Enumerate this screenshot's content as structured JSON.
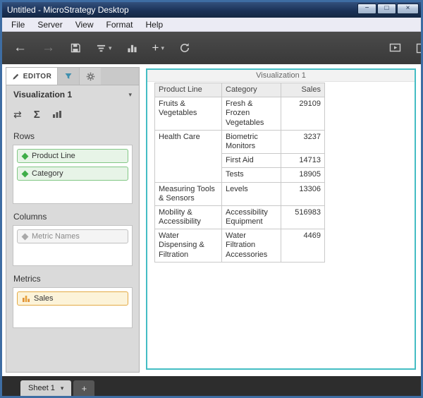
{
  "window": {
    "title": "Untitled - MicroStrategy Desktop"
  },
  "icons": {
    "minimize": "−",
    "maximize": "□",
    "close": "×",
    "back": "←",
    "forward": "→",
    "plus": "+",
    "caret_down": "▾",
    "swap": "⇄",
    "sigma": "Σ"
  },
  "menu": {
    "items": [
      "File",
      "Server",
      "View",
      "Format",
      "Help"
    ]
  },
  "editor": {
    "tab_label": "EDITOR",
    "visualization_name": "Visualization 1",
    "sections": {
      "rows": {
        "label": "Rows",
        "chips": [
          {
            "label": "Product Line"
          },
          {
            "label": "Category"
          }
        ]
      },
      "columns": {
        "label": "Columns",
        "chips": [
          {
            "label": "Metric Names"
          }
        ]
      },
      "metrics": {
        "label": "Metrics",
        "chips": [
          {
            "label": "Sales"
          }
        ]
      }
    }
  },
  "viz": {
    "title": "Visualization 1",
    "table": {
      "headers": [
        "Product Line",
        "Category",
        "Sales"
      ],
      "rows": [
        [
          "Fruits & Vegetables",
          "Fresh & Frozen Vegetables",
          "29109"
        ],
        [
          "Health Care",
          "Biometric Monitors",
          "3237"
        ],
        [
          "First Aid",
          "14713"
        ],
        [
          "Tests",
          "18905"
        ],
        [
          "Measuring Tools & Sensors",
          "Levels",
          "13306"
        ],
        [
          "Mobility & Accessibility",
          "Accessibility Equipment",
          "516983"
        ],
        [
          "Water Dispensing & Filtration",
          "Water Filtration Accessories",
          "4469"
        ]
      ]
    }
  },
  "footer": {
    "sheet_label": "Sheet 1",
    "add_label": "+"
  },
  "colors": {
    "accent_teal": "#44bdc4",
    "chip_green_border": "#82c785",
    "chip_orange_border": "#e3aa45",
    "titlebar_blue": "#1b3258"
  }
}
